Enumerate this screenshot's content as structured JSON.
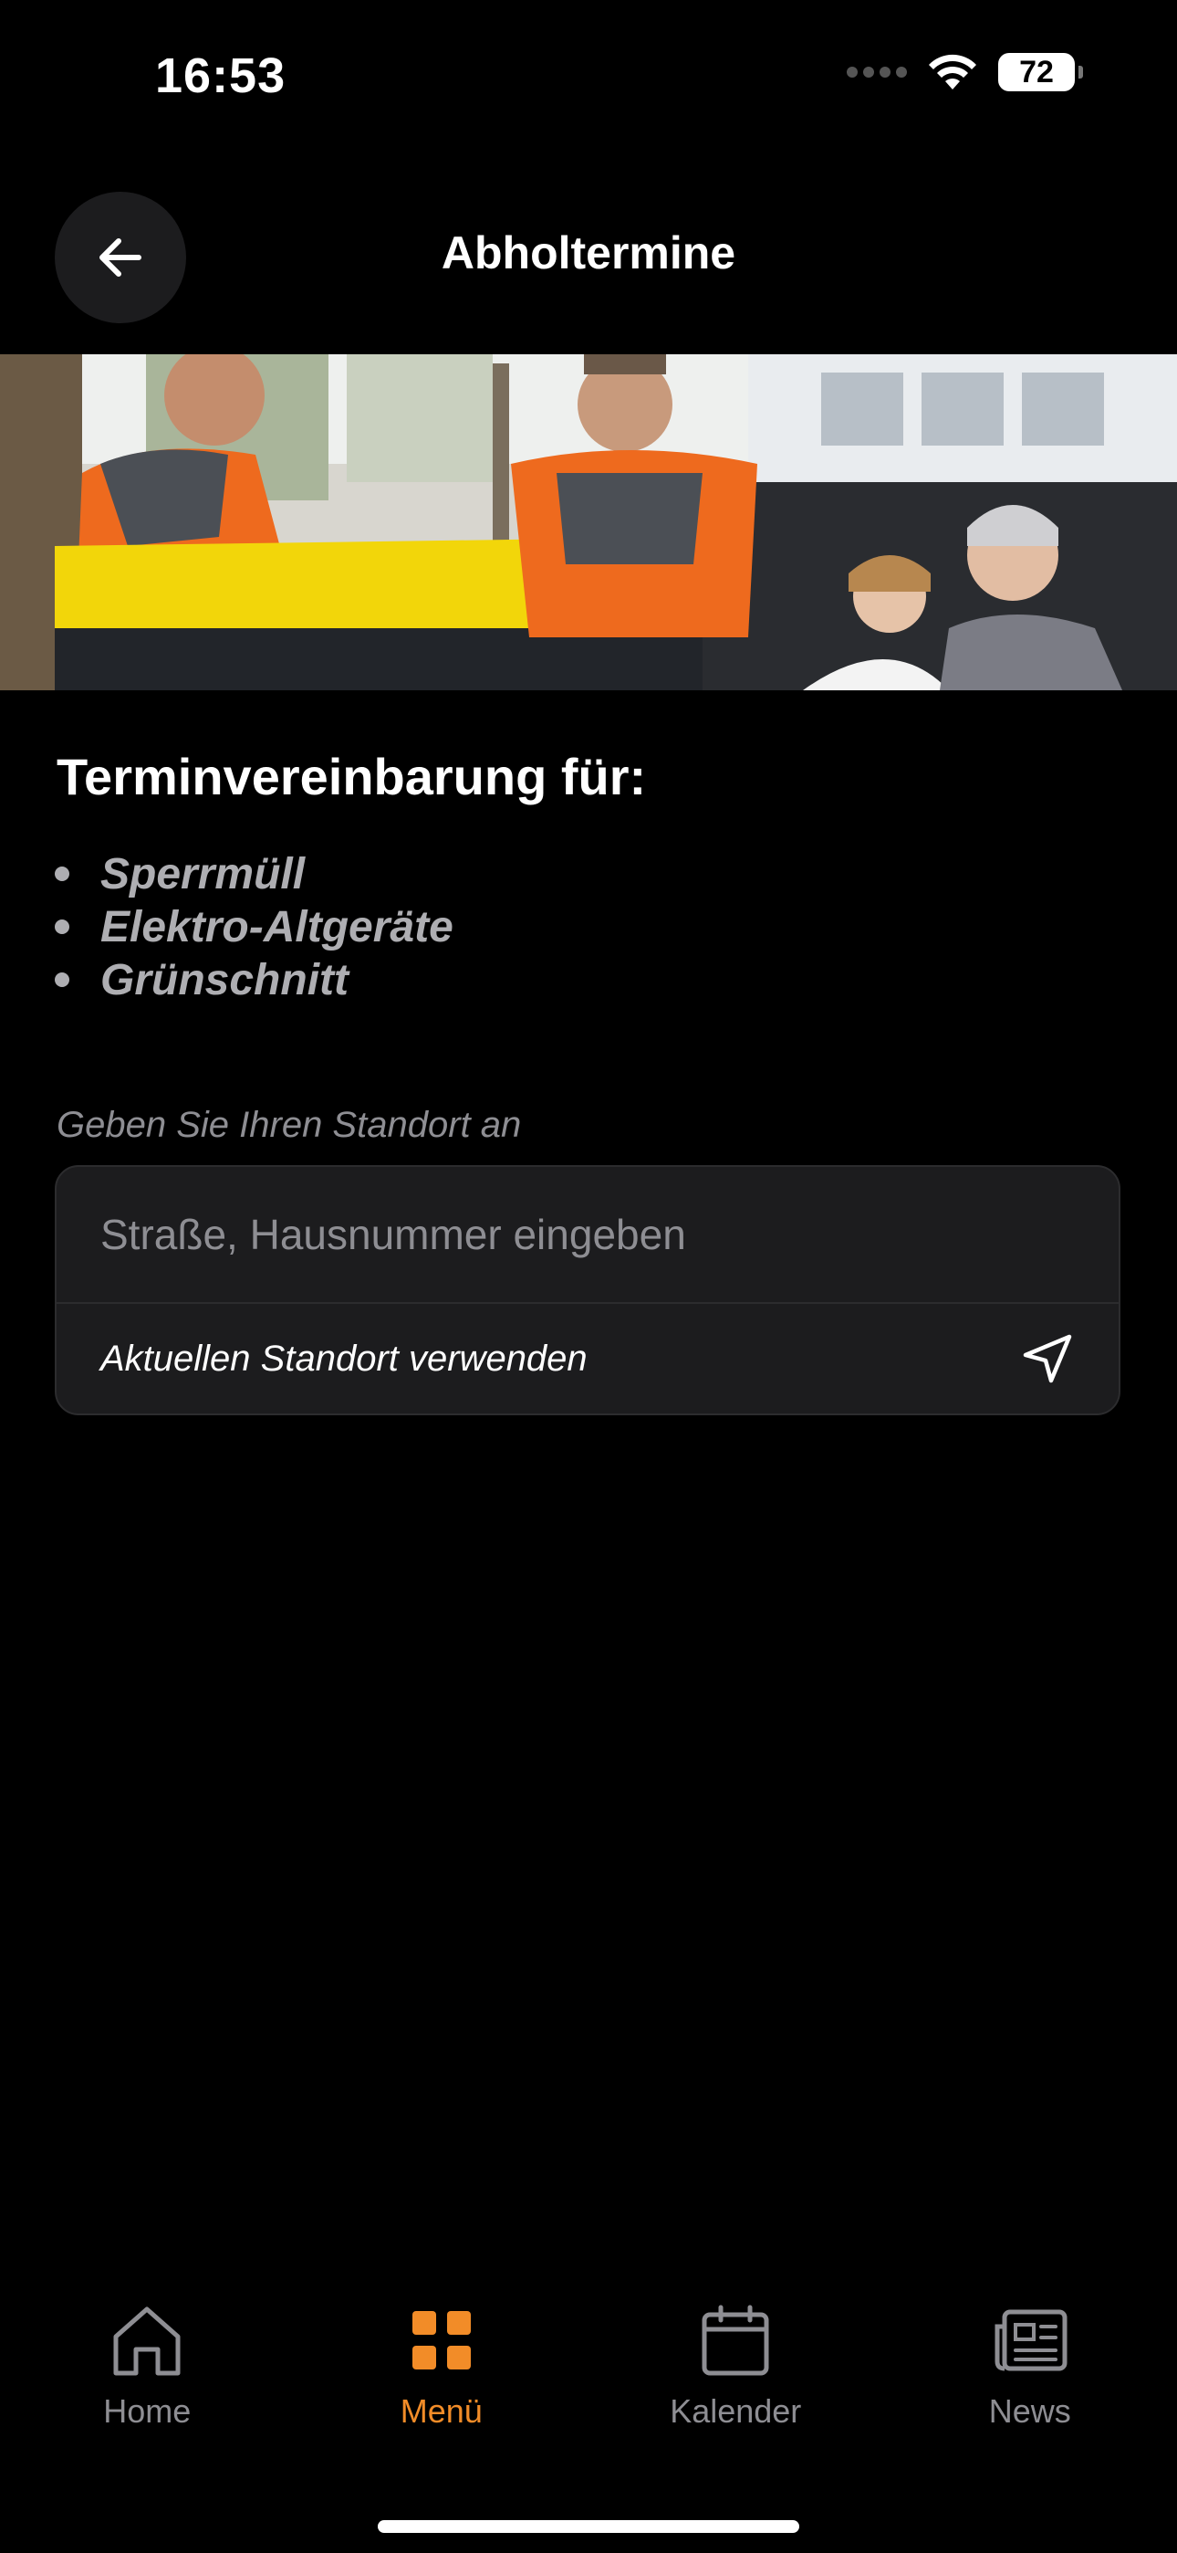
{
  "status_bar": {
    "time": "16:53",
    "battery": "72"
  },
  "header": {
    "title": "Abholtermine",
    "back_icon": "arrow-left-icon"
  },
  "content": {
    "heading": "Terminvereinbarung für:",
    "services": [
      "Sperrmüll",
      "Elektro-Altgeräte",
      "Grünschnitt"
    ],
    "location_label": "Geben Sie Ihren Standort an",
    "address_placeholder": "Straße, Hausnummer eingeben",
    "use_location_label": "Aktuellen Standort verwenden",
    "use_location_icon": "location-arrow-icon"
  },
  "tab_bar": {
    "active_color": "#f28c28",
    "inactive_color": "#8e8e93",
    "tabs": [
      {
        "label": "Home",
        "icon": "home-icon"
      },
      {
        "label": "Menü",
        "icon": "grid-icon",
        "active": true
      },
      {
        "label": "Kalender",
        "icon": "calendar-icon"
      },
      {
        "label": "News",
        "icon": "newspaper-icon"
      }
    ]
  }
}
